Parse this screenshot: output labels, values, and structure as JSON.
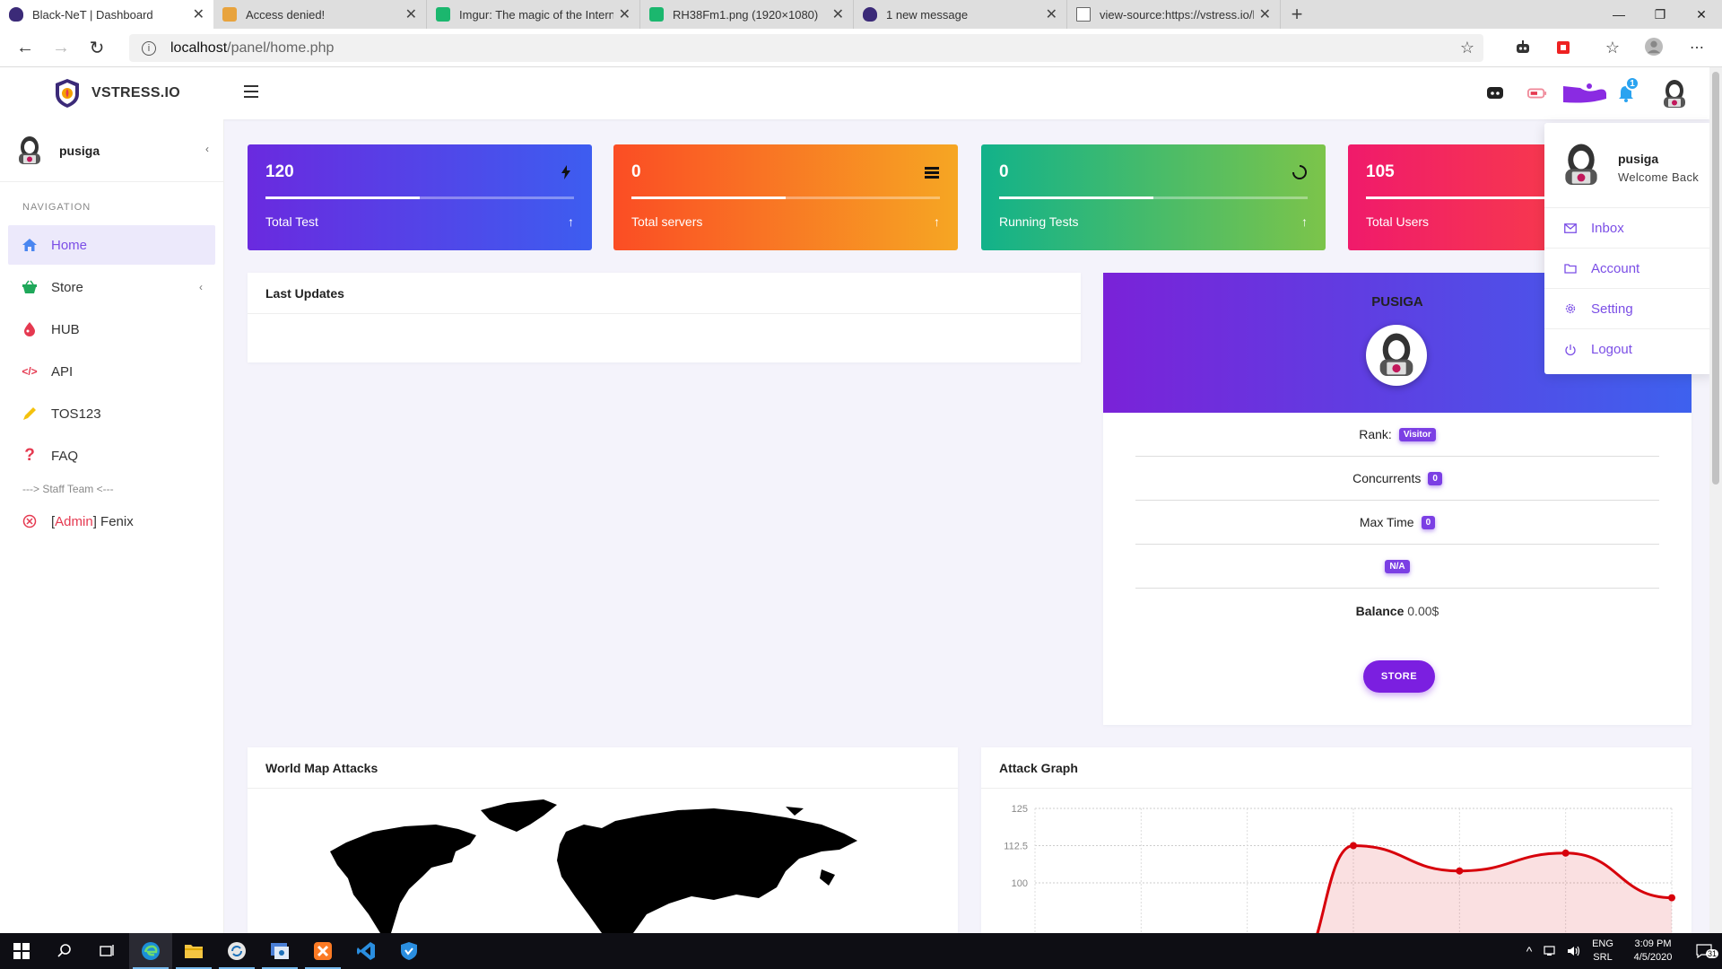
{
  "browser": {
    "tabs": [
      {
        "title": "Black-NeT | Dashboard",
        "active": true,
        "favicon_color": "#3b2a78"
      },
      {
        "title": "Access denied!",
        "active": false,
        "favicon_color": "#e8a33d"
      },
      {
        "title": "Imgur: The magic of the Internet",
        "active": false,
        "favicon_color": "#1bb76e"
      },
      {
        "title": "RH38Fm1.png (1920×1080)",
        "active": false,
        "favicon_color": "#1bb76e"
      },
      {
        "title": "1 new message",
        "active": false,
        "favicon_color": "#3b2a78"
      },
      {
        "title": "view-source:https://vstress.io/ho",
        "active": false,
        "favicon_color": "#888888"
      }
    ],
    "url_host": "localhost",
    "url_path": "/panel/home.php"
  },
  "brand": {
    "name": "VSTRESS.IO"
  },
  "header": {
    "notification_count": "1"
  },
  "sidebar": {
    "username": "pusiga",
    "nav_title": "NAVIGATION",
    "items": [
      {
        "label": "Home",
        "icon": "home-icon",
        "color": "#7b4ee6",
        "active": true
      },
      {
        "label": "Store",
        "icon": "basket-icon",
        "color": "#1fa85a",
        "active": false
      },
      {
        "label": "HUB",
        "icon": "drop-icon",
        "color": "#e53950",
        "active": false
      },
      {
        "label": "API",
        "icon": "code-icon",
        "color": "#e53950",
        "active": false
      },
      {
        "label": "TOS123",
        "icon": "pencil-icon",
        "color": "#f4c20d",
        "active": false
      },
      {
        "label": "FAQ",
        "icon": "question-icon",
        "color": "#e53950",
        "active": false
      }
    ],
    "staff_label": "---> Staff Team <---",
    "staff": {
      "bracket_open": "[",
      "role": "Admin",
      "bracket_close": "]",
      "name": " Fenix"
    }
  },
  "stats": [
    {
      "value": "120",
      "label": "Total Test",
      "progress": 0.5,
      "icon": "bolt-icon",
      "gradient": [
        "#6a2adf",
        "#3d5df0"
      ]
    },
    {
      "value": "0",
      "label": "Total servers",
      "progress": 0.5,
      "icon": "server-icon",
      "gradient": [
        "#fb4d24",
        "#f6a623"
      ]
    },
    {
      "value": "0",
      "label": "Running Tests",
      "progress": 0.5,
      "icon": "spinner-icon",
      "gradient": [
        "#12b28a",
        "#7cc44a"
      ]
    },
    {
      "value": "105",
      "label": "Total Users",
      "progress": 0.85,
      "icon": "users-icon",
      "gradient": [
        "#f01a6b",
        "#fb4d3a"
      ]
    }
  ],
  "updates": {
    "title": "Last Updates"
  },
  "profile": {
    "name": "PUSIGA",
    "rank_label": "Rank:",
    "rank_value": "Visitor",
    "concurrents_label": "Concurrents",
    "concurrents_value": "0",
    "maxtime_label": "Max Time",
    "maxtime_value": "0",
    "plan_value": "N/A",
    "balance_label": "Balance",
    "balance_value": " 0.00$",
    "store_button": "STORE"
  },
  "worldmap": {
    "title": "World Map Attacks"
  },
  "attack_graph": {
    "title": "Attack Graph"
  },
  "chart_data": {
    "type": "area",
    "title": "Attack Graph",
    "y_ticks": [
      "125",
      "112.5",
      "100"
    ],
    "ylim": [
      100,
      125
    ],
    "x_index": [
      0,
      1,
      2,
      3,
      4,
      5,
      6
    ],
    "series": [
      {
        "values": [
          null,
          null,
          null,
          112.5,
          104,
          110,
          95
        ]
      }
    ],
    "color": "#d7000b",
    "grid": true
  },
  "dropdown": {
    "name": "pusiga",
    "welcome": "Welcome Back",
    "items": [
      {
        "label": "Inbox",
        "icon": "mail-icon"
      },
      {
        "label": "Account",
        "icon": "folder-icon"
      },
      {
        "label": "Setting",
        "icon": "gear-icon"
      },
      {
        "label": "Logout",
        "icon": "power-icon"
      }
    ]
  },
  "taskbar": {
    "lang_top": "ENG",
    "lang_bottom": "SRL",
    "time": "3:09 PM",
    "date": "4/5/2020",
    "notif_count": "31"
  }
}
